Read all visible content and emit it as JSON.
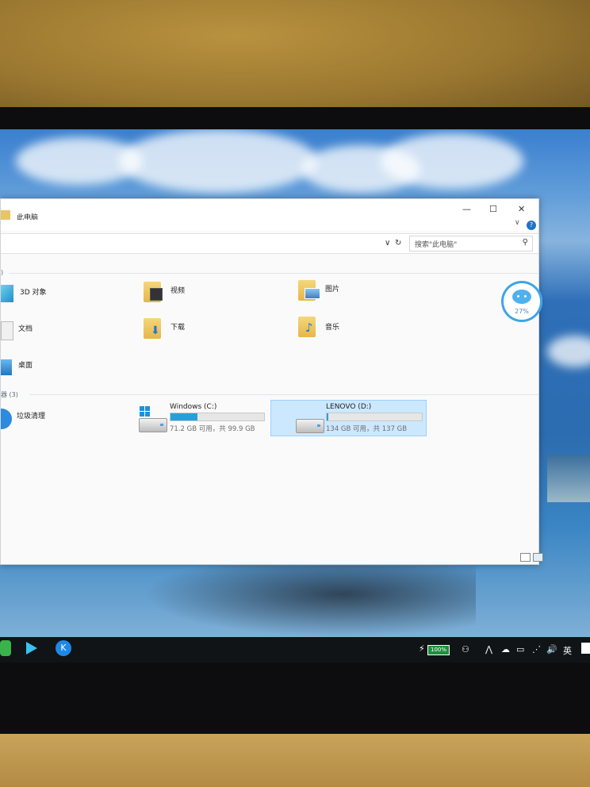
{
  "window": {
    "title": "此电脑",
    "controls": {
      "minimize": "—",
      "maximize": "☐",
      "close": "✕"
    },
    "help_label": "?",
    "ribbon_chevron": "∨"
  },
  "address": {
    "chevron": "∨",
    "refresh": "↻",
    "search_placeholder": "搜索\"此电脑\""
  },
  "sections": {
    "folders_header": ")",
    "devices_header": "器 (3)"
  },
  "folders": [
    {
      "label": "3D 对象",
      "icon": "cube-3d-icon"
    },
    {
      "label": "视频",
      "icon": "video-folder-icon"
    },
    {
      "label": "图片",
      "icon": "pictures-folder-icon"
    },
    {
      "label": "文档",
      "icon": "documents-icon"
    },
    {
      "label": "下载",
      "icon": "downloads-folder-icon"
    },
    {
      "label": "音乐",
      "icon": "music-folder-icon"
    },
    {
      "label": "桌面",
      "icon": "desktop-folder-icon"
    }
  ],
  "devices": [
    {
      "label": "垃圾清理",
      "icon": "cleanup-icon"
    },
    {
      "name": "Windows (C:)",
      "detail": "71.2 GB 可用，共 99.9 GB",
      "used_fraction": 0.29
    },
    {
      "name": "LENOVO (D:)",
      "detail": "134 GB 可用，共 137 GB",
      "used_fraction": 0.02,
      "selected": true
    }
  ],
  "float_widget": {
    "percent": "27%"
  },
  "taskbar": {
    "battery": "100%",
    "tray_ime": "英",
    "tray_volume": "🔊",
    "tray_up": "⋀"
  },
  "colors": {
    "accent": "#26a0da",
    "selection": "#cce8ff"
  }
}
